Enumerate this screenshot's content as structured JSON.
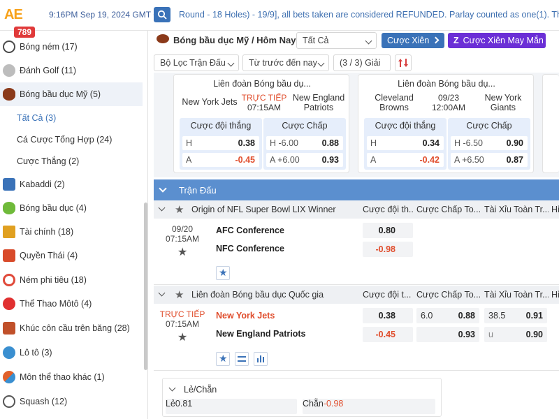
{
  "topbar": {
    "logo_text": "AE",
    "logo_sub": "789",
    "time": "9:16PM Sep 19, 2024 GMT +7",
    "marquee": "Round - 18 Holes) - 19/9], all bets taken are considered REFUNDED. Parlay counted as one(1). Than"
  },
  "sidebar": {
    "items": [
      {
        "label": "Bóng ném",
        "count": "(17)",
        "icon": "handball-icon",
        "color": "#4a4a4a"
      },
      {
        "label": "Đánh Golf",
        "count": "(11)",
        "icon": "golf-icon",
        "color": "#9a9a9a"
      },
      {
        "label": "Bóng bầu dục Mỹ",
        "count": "(5)",
        "icon": "american-football-icon",
        "color": "#8b3a1a"
      }
    ],
    "subitems": [
      {
        "label": "Tất Cả",
        "count": "(3)"
      },
      {
        "label": "Cá Cược Tổng Hợp",
        "count": "(24)"
      },
      {
        "label": "Cược Thắng",
        "count": "(2)"
      }
    ],
    "items2": [
      {
        "label": "Kabaddi",
        "count": "(2)",
        "icon": "kabaddi-icon",
        "color": "#3a72b8"
      },
      {
        "label": "Bóng bầu dục",
        "count": "(4)",
        "icon": "rugby-icon",
        "color": "#6fba3a"
      },
      {
        "label": "Tài chính",
        "count": "(18)",
        "icon": "finance-icon",
        "color": "#e0a020"
      },
      {
        "label": "Quyền Thái",
        "count": "(4)",
        "icon": "muay-thai-icon",
        "color": "#d84a2a"
      },
      {
        "label": "Ném phi tiêu",
        "count": "(18)",
        "icon": "darts-icon",
        "color": "#e04a3a"
      },
      {
        "label": "Thể Thao Môtô",
        "count": "(4)",
        "icon": "motorsport-icon",
        "color": "#e03030"
      },
      {
        "label": "Khúc côn cầu trên băng",
        "count": "(28)",
        "icon": "ice-hockey-icon",
        "color": "#c0502a"
      },
      {
        "label": "Lô tô",
        "count": "(3)",
        "icon": "lotto-icon",
        "color": "#3a8fd0"
      },
      {
        "label": "Môn thể thao khác",
        "count": "(1)",
        "icon": "other-sports-icon",
        "color": "#e0602a"
      },
      {
        "label": "Squash",
        "count": "(12)",
        "icon": "squash-icon",
        "color": "#555555"
      }
    ]
  },
  "header": {
    "title": "Bóng bầu dục Mỹ / Hôm Nay",
    "filter_all": "Tất Cả",
    "parlay_btn": "Cược Xiên",
    "lucky_parlay_btn": "Cược Xiên May Mắn",
    "match_filter": "Bộ Lọc Trận Đấu",
    "time_filter": "Từ trước đến nay",
    "league_count": "(3 / 3) Giải"
  },
  "cards": [
    {
      "league": "Liên đoàn Bóng bầu dụ...",
      "home": "New York Jets",
      "status": "TRỰC TIẾP",
      "time": "07:15AM",
      "away": "New England Patriots",
      "win_label": "Cược đội thắng",
      "hcp_label": "Cược Chấp",
      "rows": [
        {
          "side": "H",
          "win": "0.38",
          "hcp": "H -6.00",
          "hcp_odds": "0.88"
        },
        {
          "side": "A",
          "win": "-0.45",
          "hcp": "A +6.00",
          "hcp_odds": "0.93"
        }
      ]
    },
    {
      "league": "Liên đoàn Bóng bầu dụ...",
      "home": "Cleveland Browns",
      "status": "09/23",
      "time": "12:00AM",
      "away": "New York Giants",
      "win_label": "Cược đội thắng",
      "hcp_label": "Cược Chấp",
      "rows": [
        {
          "side": "H",
          "win": "0.34",
          "hcp": "H -6.50",
          "hcp_odds": "0.90"
        },
        {
          "side": "A",
          "win": "-0.42",
          "hcp": "A +6.50",
          "hcp_odds": "0.87"
        }
      ]
    }
  ],
  "section": {
    "title": "Trận Đấu"
  },
  "columns": {
    "win": "Cược đội t...",
    "win_full": "Cược đội th...",
    "hcp": "Cược Chấp To...",
    "ou": "Tài Xỉu Toàn Tr...",
    "extra": "Hi"
  },
  "leagues": [
    {
      "name": "Origin of NFL Super Bowl LIX Winner",
      "match": {
        "date": "09/20",
        "time": "07:15AM",
        "teams": [
          "AFC Conference",
          "NFC Conference"
        ],
        "win": [
          "0.80",
          "-0.98"
        ]
      }
    },
    {
      "name": "Liên đoàn Bóng bầu dục Quốc gia",
      "match": {
        "date": "TRỰC TIẾP",
        "time": "07:15AM",
        "teams": [
          "New York Jets",
          "New England Patriots"
        ],
        "win": [
          "0.38",
          "-0.45"
        ],
        "hcp_line": "6.0",
        "hcp": [
          "0.88",
          "0.93"
        ],
        "ou_line": [
          "38.5",
          "u"
        ],
        "ou": [
          "0.91",
          "0.90"
        ]
      }
    }
  ],
  "even_odd": {
    "title": "Lẻ/Chẵn",
    "odd_label": "Lẻ",
    "odd_val": "0.81",
    "even_label": "Chẵn",
    "even_val": "-0.98"
  }
}
